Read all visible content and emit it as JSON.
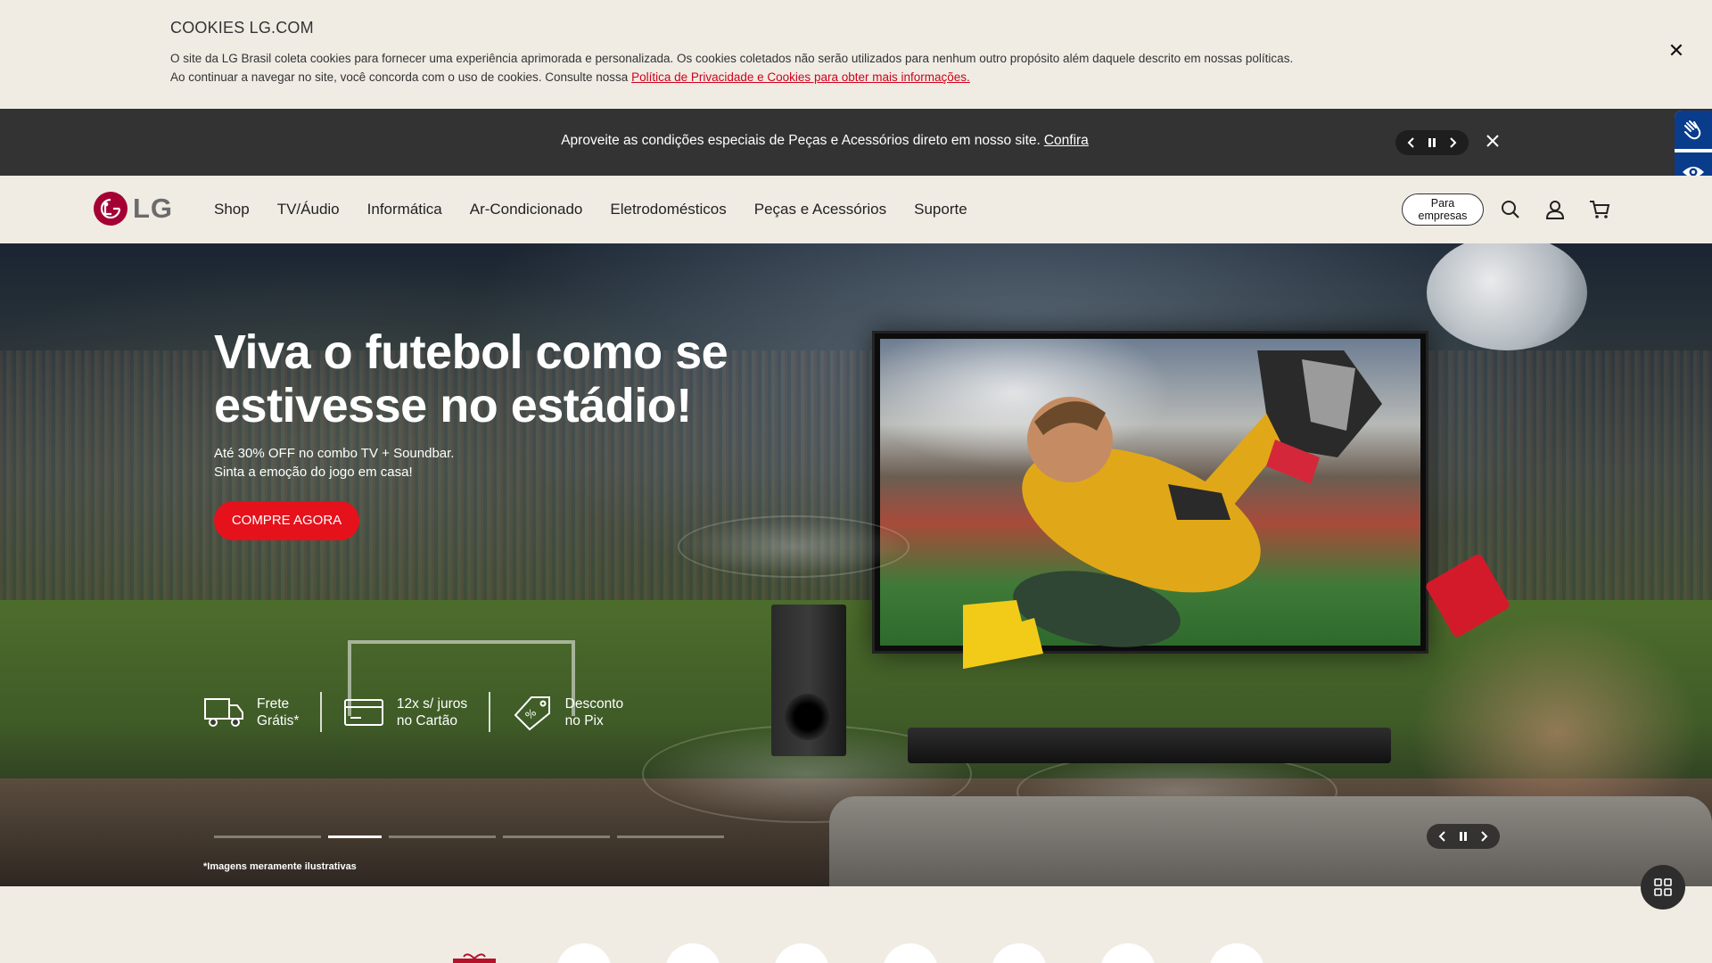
{
  "cookie": {
    "title": "COOKIES LG.COM",
    "line1": "O site da LG Brasil coleta cookies para fornecer uma experiência aprimorada e personalizada. Os cookies coletados não serão utilizados para nenhum outro propósito além daquele descrito em nossas políticas.",
    "line2": "Ao continuar a navegar no site, você concorda com o uso de cookies. Consulte nossa",
    "link": "Política de Privacidade e Cookies para obter mais informações.",
    "close_icon": "close-icon"
  },
  "promo": {
    "message": "Aproveite as condições especiais de Peças e Acessórios direto em nosso site.",
    "link": "Confira"
  },
  "header": {
    "logo_text": "LG",
    "nav": [
      "Shop",
      "TV/Áudio",
      "Informática",
      "Ar-Condicionado",
      "Eletrodomésticos",
      "Peças e Acessórios",
      "Suporte"
    ],
    "business_line1": "Para",
    "business_line2": "empresas",
    "icons": [
      "search-icon",
      "user-icon",
      "cart-icon"
    ]
  },
  "hero": {
    "title": "Viva o futebol como se estivesse no estádio!",
    "subtitle_line1": "Até 30% OFF no combo TV + Soundbar.",
    "subtitle_line2": "Sinta a emoção do jogo em casa!",
    "cta": "COMPRE AGORA",
    "benefits": [
      {
        "line1": "Frete",
        "line2": "Grátis*",
        "icon": "truck-icon"
      },
      {
        "line1": "12x s/ juros",
        "line2": "no Cartão",
        "icon": "card-icon"
      },
      {
        "line1": "Desconto",
        "line2": "no Pix",
        "icon": "tag-icon"
      }
    ],
    "disclaimer": "*Imagens meramente ilustrativas",
    "slides_total": 5,
    "active_slide": 2
  },
  "colors": {
    "accent": "#e5121c",
    "brand": "#a50034",
    "promo_bar": "#333333",
    "background": "#f0ece4",
    "accessibility": "#0a3c8c"
  }
}
